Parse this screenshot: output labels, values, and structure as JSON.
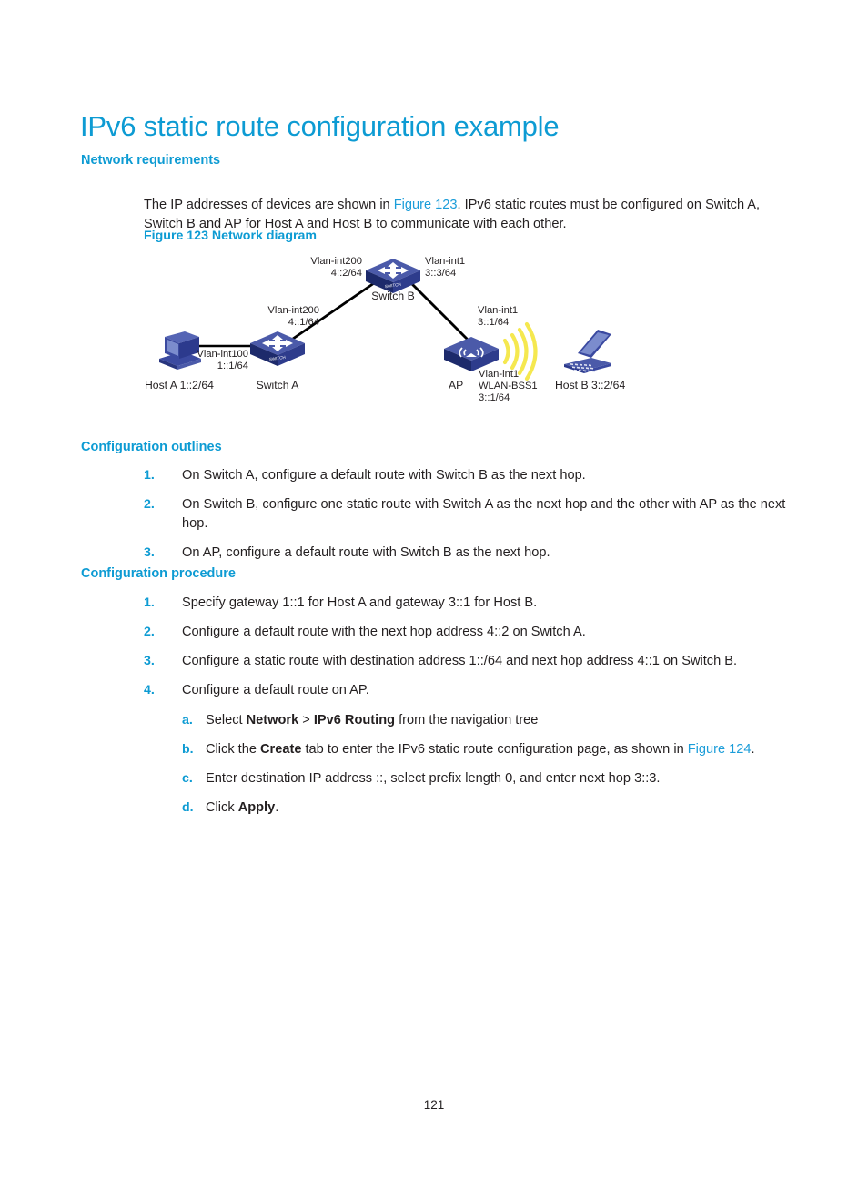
{
  "document": {
    "title": "IPv6 static route configuration example",
    "page_number": "121",
    "accent_color": "#0d9bd3",
    "link_color": "#1b9dd9",
    "text_color": "#231f20"
  },
  "sections": {
    "network_requirements": {
      "heading": "Network requirements",
      "paragraph_part1": "The IP addresses of devices are shown in ",
      "paragraph_link": "Figure 123",
      "paragraph_part2": ". IPv6 static routes must be configured on Switch A, Switch B and AP for Host A and Host B to communicate with each other."
    },
    "configuration_outlines": {
      "heading": "Configuration outlines",
      "items": [
        {
          "num": "1.",
          "text": "On Switch A, configure a default route with Switch B as the next hop."
        },
        {
          "num": "2.",
          "text": "On Switch B, configure one static route with Switch A as the next hop and the other with AP as the next hop."
        },
        {
          "num": "3.",
          "text": "On AP, configure a default route with Switch B as the next hop."
        }
      ]
    },
    "configuration_procedure": {
      "heading": "Configuration procedure",
      "items": [
        {
          "num": "1.",
          "text": "Specify gateway 1::1 for Host A and gateway 3::1 for Host B."
        },
        {
          "num": "2.",
          "text": "Configure a default route with the next hop address 4::2 on Switch A."
        },
        {
          "num": "3.",
          "text": "Configure a static route with destination address 1::/64 and next hop address 4::1 on Switch B."
        },
        {
          "num": "4.",
          "text": "Configure a default route on AP."
        }
      ],
      "substeps": [
        {
          "letter": "a.",
          "pre": "Select ",
          "bold1": "Network",
          "mid": " > ",
          "bold2": "IPv6 Routing",
          "post": " from the navigation tree"
        },
        {
          "letter": "b.",
          "pre": "Click the ",
          "bold1": "Create",
          "post": " tab to enter the IPv6 static route configuration page, as shown in ",
          "link": "Figure 124",
          "tail": "."
        },
        {
          "letter": "c.",
          "pre": "Enter destination IP address ::, select prefix length 0, and enter next hop 3::3."
        },
        {
          "letter": "d.",
          "pre": "Click ",
          "bold1": "Apply",
          "post": "."
        }
      ]
    }
  },
  "figure": {
    "caption": "Figure 123 Network diagram",
    "colors": {
      "device_top": "#4a58a8",
      "device_face": "#2b3a8f",
      "device_side": "#1e2a6b",
      "wave": "#f5e84f",
      "link": "#000000"
    },
    "nodes": {
      "switch_b": {
        "name": "Switch B",
        "left_iface": "Vlan-int200",
        "left_addr": "4::2/64",
        "right_iface": "Vlan-int1",
        "right_addr": "3::3/64"
      },
      "switch_a": {
        "name": "Switch A",
        "up_iface": "Vlan-int200",
        "up_addr": "4::1/64",
        "left_iface": "Vlan-int100",
        "left_addr": "1::1/64"
      },
      "ap": {
        "name": "AP",
        "up_iface": "Vlan-int1",
        "up_addr": "3::1/64",
        "bss_iface": "Vlan-int1",
        "bss_name": "WLAN-BSS1",
        "bss_addr": "3::1/64"
      },
      "host_a": {
        "label": "Host A 1::2/64"
      },
      "host_b": {
        "label": "Host B 3::2/64"
      }
    }
  }
}
